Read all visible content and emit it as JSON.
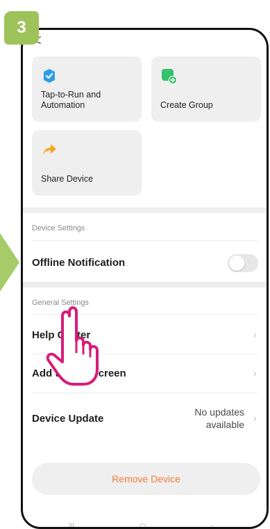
{
  "step": {
    "number": "3"
  },
  "header": {
    "back_label": "<"
  },
  "quick_actions": [
    {
      "label_line1": "Tap-to-Run and",
      "label_line2": "Automation",
      "icon": "check-icon",
      "color": "#2f9ce8"
    },
    {
      "label_line1": "Create Group",
      "label_line2": "",
      "icon": "add-group-icon",
      "color": "#36c26b"
    },
    {
      "label_line1": "Share Device",
      "label_line2": "",
      "icon": "share-arrow-icon",
      "color": "#f5a623"
    }
  ],
  "device_settings": {
    "title": "Device Settings",
    "offline_notification": {
      "label": "Offline Notification",
      "enabled": false
    }
  },
  "general_settings": {
    "title": "General Settings",
    "help_center": "Help Center",
    "add_to_home_screen": "Add to",
    "add_to_home_screen_tail": "creen",
    "device_update": {
      "label": "Device Update",
      "status_line1": "No updates",
      "status_line2": "available"
    }
  },
  "remove_device": "Remove Device",
  "accent_colors": {
    "step_badge": "#9dc35a",
    "remove_text": "#f07c3a",
    "pointer": "#d81b7a"
  }
}
